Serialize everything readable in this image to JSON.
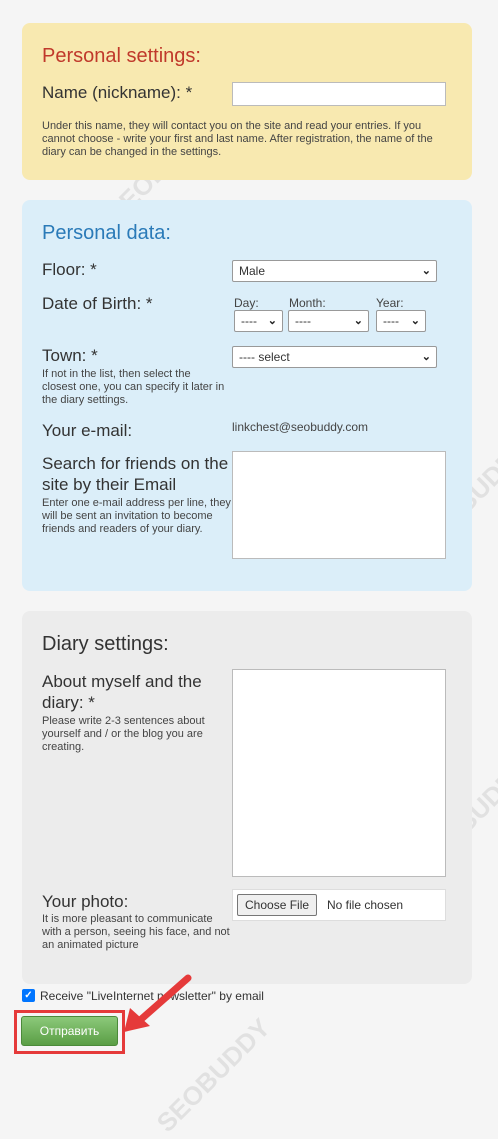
{
  "personal": {
    "title": "Personal settings:",
    "name_label": "Name (nickname): *",
    "name_value": "",
    "hint": "Under this name, they will contact you on the site and read your entries. If you cannot choose - write your first and last name. After registration, the name of the diary can be changed in the settings."
  },
  "data": {
    "title": "Personal data:",
    "floor_label": "Floor: *",
    "floor_value": "Male",
    "dob_label": "Date of Birth: *",
    "day_label": "Day:",
    "month_label": "Month:",
    "year_label": "Year:",
    "day_value": "----",
    "month_value": "----",
    "year_value": "----",
    "town_label": "Town: *",
    "town_hint": "If not in the list, then select the closest one, you can specify it later in the diary settings.",
    "town_value": "---- select",
    "email_label": "Your e-mail:",
    "email_value": "linkchest@seobuddy.com",
    "friends_label": "Search for friends on the site by their Email",
    "friends_hint": "Enter one e-mail address per line, they will be sent an invitation to become friends and readers of your diary."
  },
  "diary": {
    "title": "Diary settings:",
    "about_label": "About myself and the diary: *",
    "about_hint": "Please write 2-3 sentences about yourself and / or the blog you are creating.",
    "photo_label": "Your photo:",
    "photo_hint": "It is more pleasant to communicate with a person, seeing his face, and not an animated picture",
    "file_button": "Choose File",
    "file_status": "No file chosen"
  },
  "newsletter": {
    "label": "Receive \"LiveInternet newsletter\" by email",
    "checked": true
  },
  "submit_label": "Отправить",
  "watermark": "SEOBUDDY",
  "colors": {
    "personal_bg": "#f8e9b0",
    "data_bg": "#dbeef9",
    "diary_bg": "#ececec",
    "personal_title": "#c0392b",
    "data_title": "#2a7ab8",
    "highlight": "#e53a3a",
    "submit": "#6aaa55"
  }
}
